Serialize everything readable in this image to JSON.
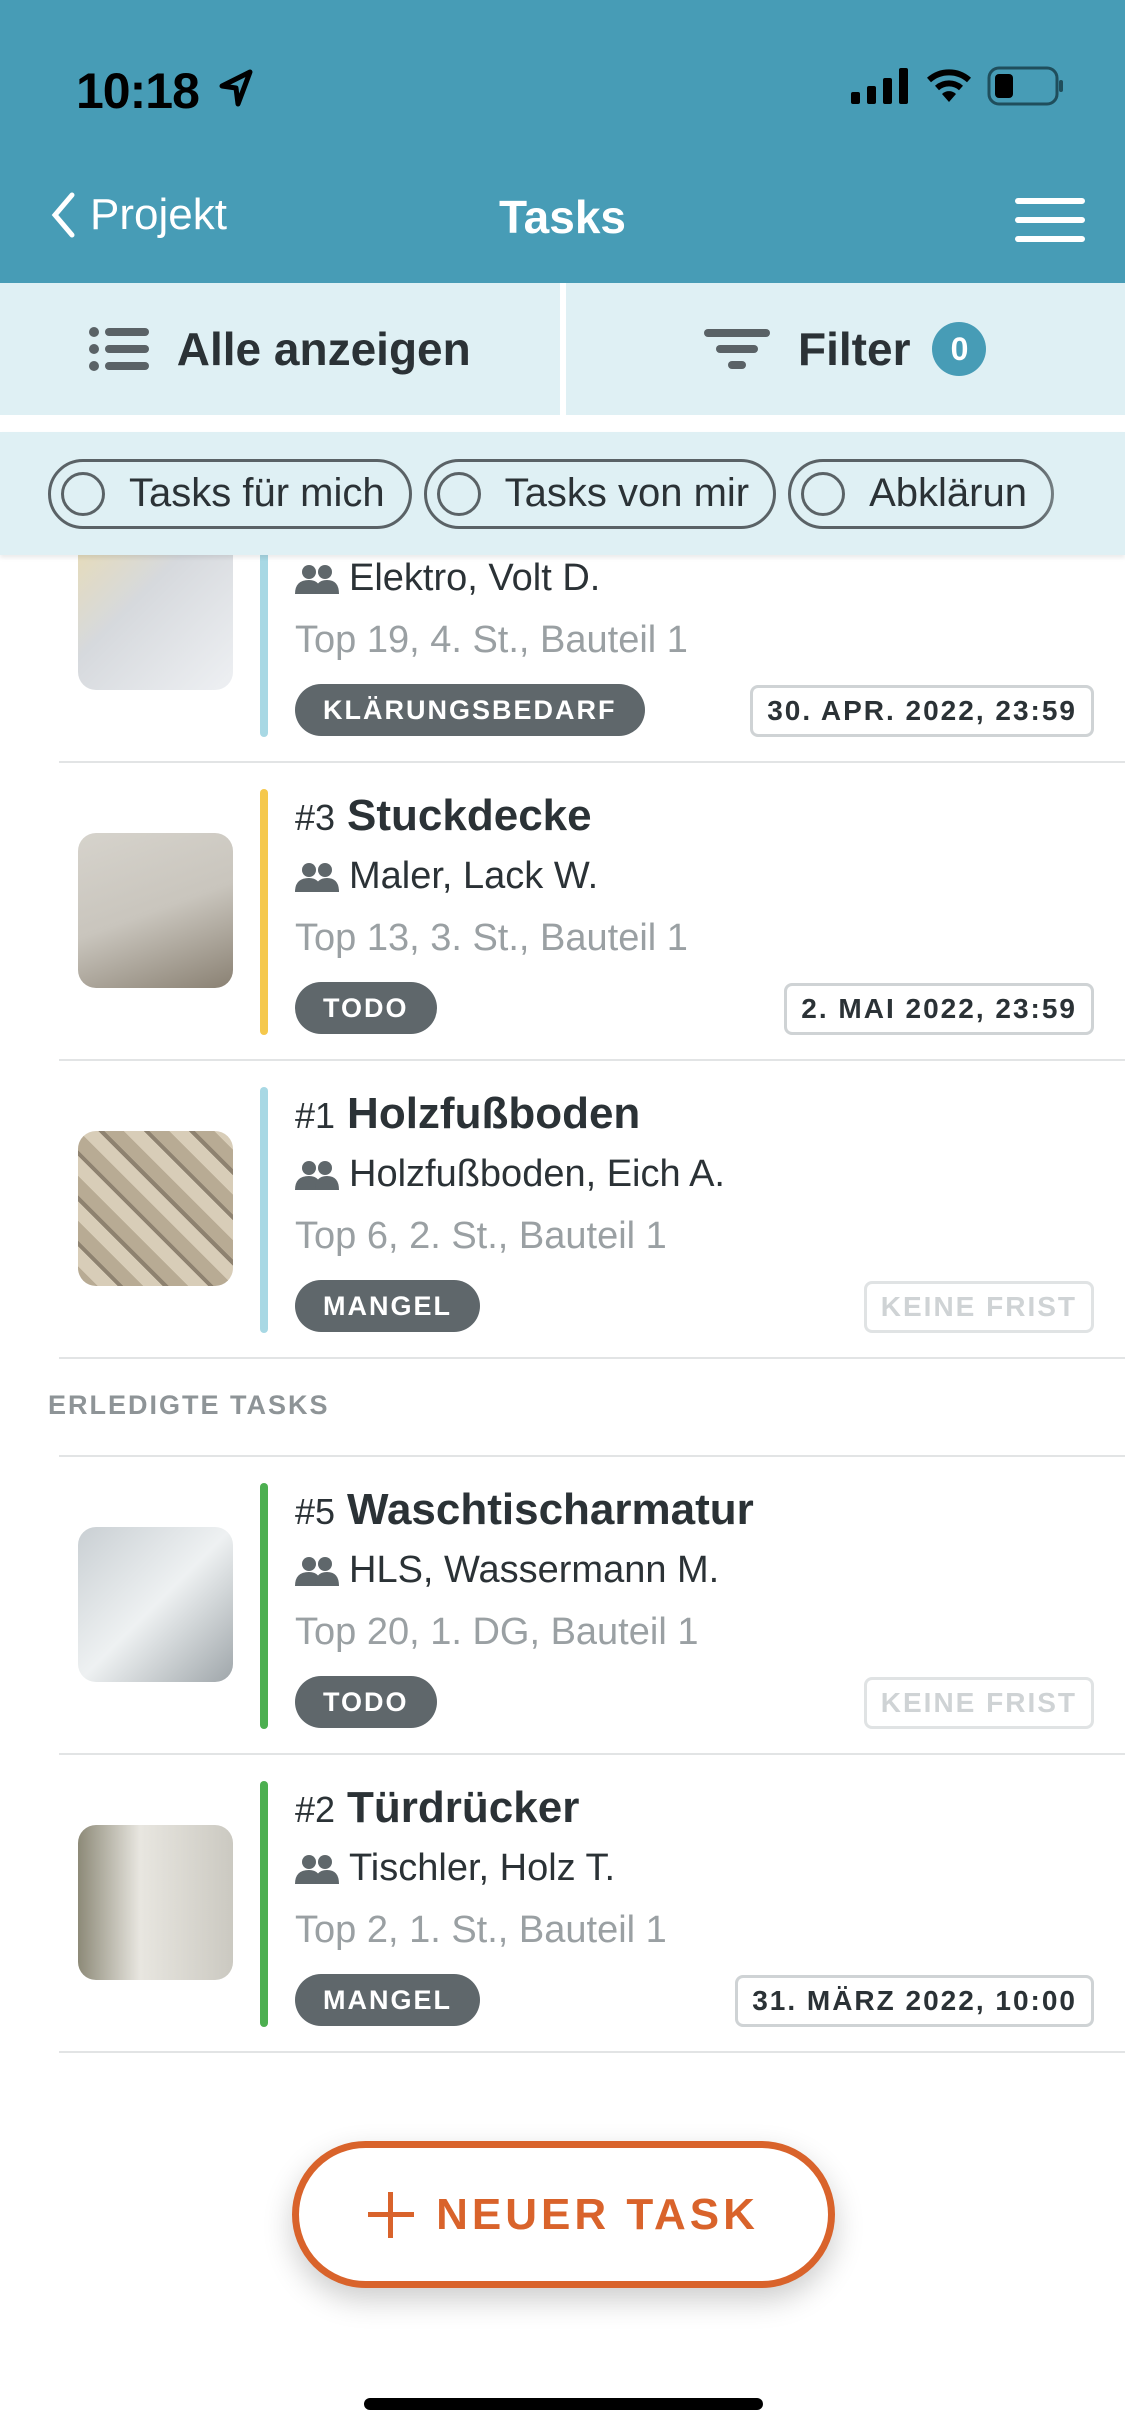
{
  "status_bar": {
    "time": "10:18"
  },
  "nav": {
    "back_label": "Projekt",
    "title": "Tasks"
  },
  "toolbar": {
    "show_all_label": "Alle anzeigen",
    "filter_label": "Filter",
    "filter_count": "0"
  },
  "chips": [
    {
      "label": "Tasks für mich"
    },
    {
      "label": "Tasks von mir"
    },
    {
      "label": "Abklärun"
    }
  ],
  "colors": {
    "header": "#479cb6",
    "accent": "#d9632b",
    "badge": "#5f676b"
  },
  "open_tasks": [
    {
      "number": "",
      "title": "",
      "assignee": "Elektro, Volt D.",
      "location": "Top 19, 4. St., Bauteil 1",
      "status": "KLÄRUNGSBEDARF",
      "due": "30. APR. 2022, 23:59",
      "bar_color": "#a8d8e4"
    },
    {
      "number": "#3",
      "title": "Stuckdecke",
      "assignee": "Maler, Lack W.",
      "location": "Top 13, 3. St., Bauteil 1",
      "status": "TODO",
      "due": "2. MAI 2022, 23:59",
      "bar_color": "#f5c84c"
    },
    {
      "number": "#1",
      "title": "Holzfußboden",
      "assignee": "Holzfußboden, Eich A.",
      "location": "Top 6, 2. St., Bauteil 1",
      "status": "MANGEL",
      "due": "KEINE FRIST",
      "bar_color": "#a8d8e4"
    }
  ],
  "done_section": {
    "label": "ERLEDIGTE TASKS"
  },
  "done_tasks": [
    {
      "number": "#5",
      "title": "Waschtischarmatur",
      "assignee": "HLS, Wassermann M.",
      "location": "Top 20, 1. DG, Bauteil 1",
      "status": "TODO",
      "due": "KEINE FRIST",
      "bar_color": "#4caf50"
    },
    {
      "number": "#2",
      "title": "Türdrücker",
      "assignee": "Tischler, Holz T.",
      "location": "Top 2, 1. St., Bauteil 1",
      "status": "MANGEL",
      "due": "31. MÄRZ 2022, 10:00",
      "bar_color": "#4caf50"
    }
  ],
  "fab": {
    "icon": "+",
    "label": "NEUER TASK"
  }
}
